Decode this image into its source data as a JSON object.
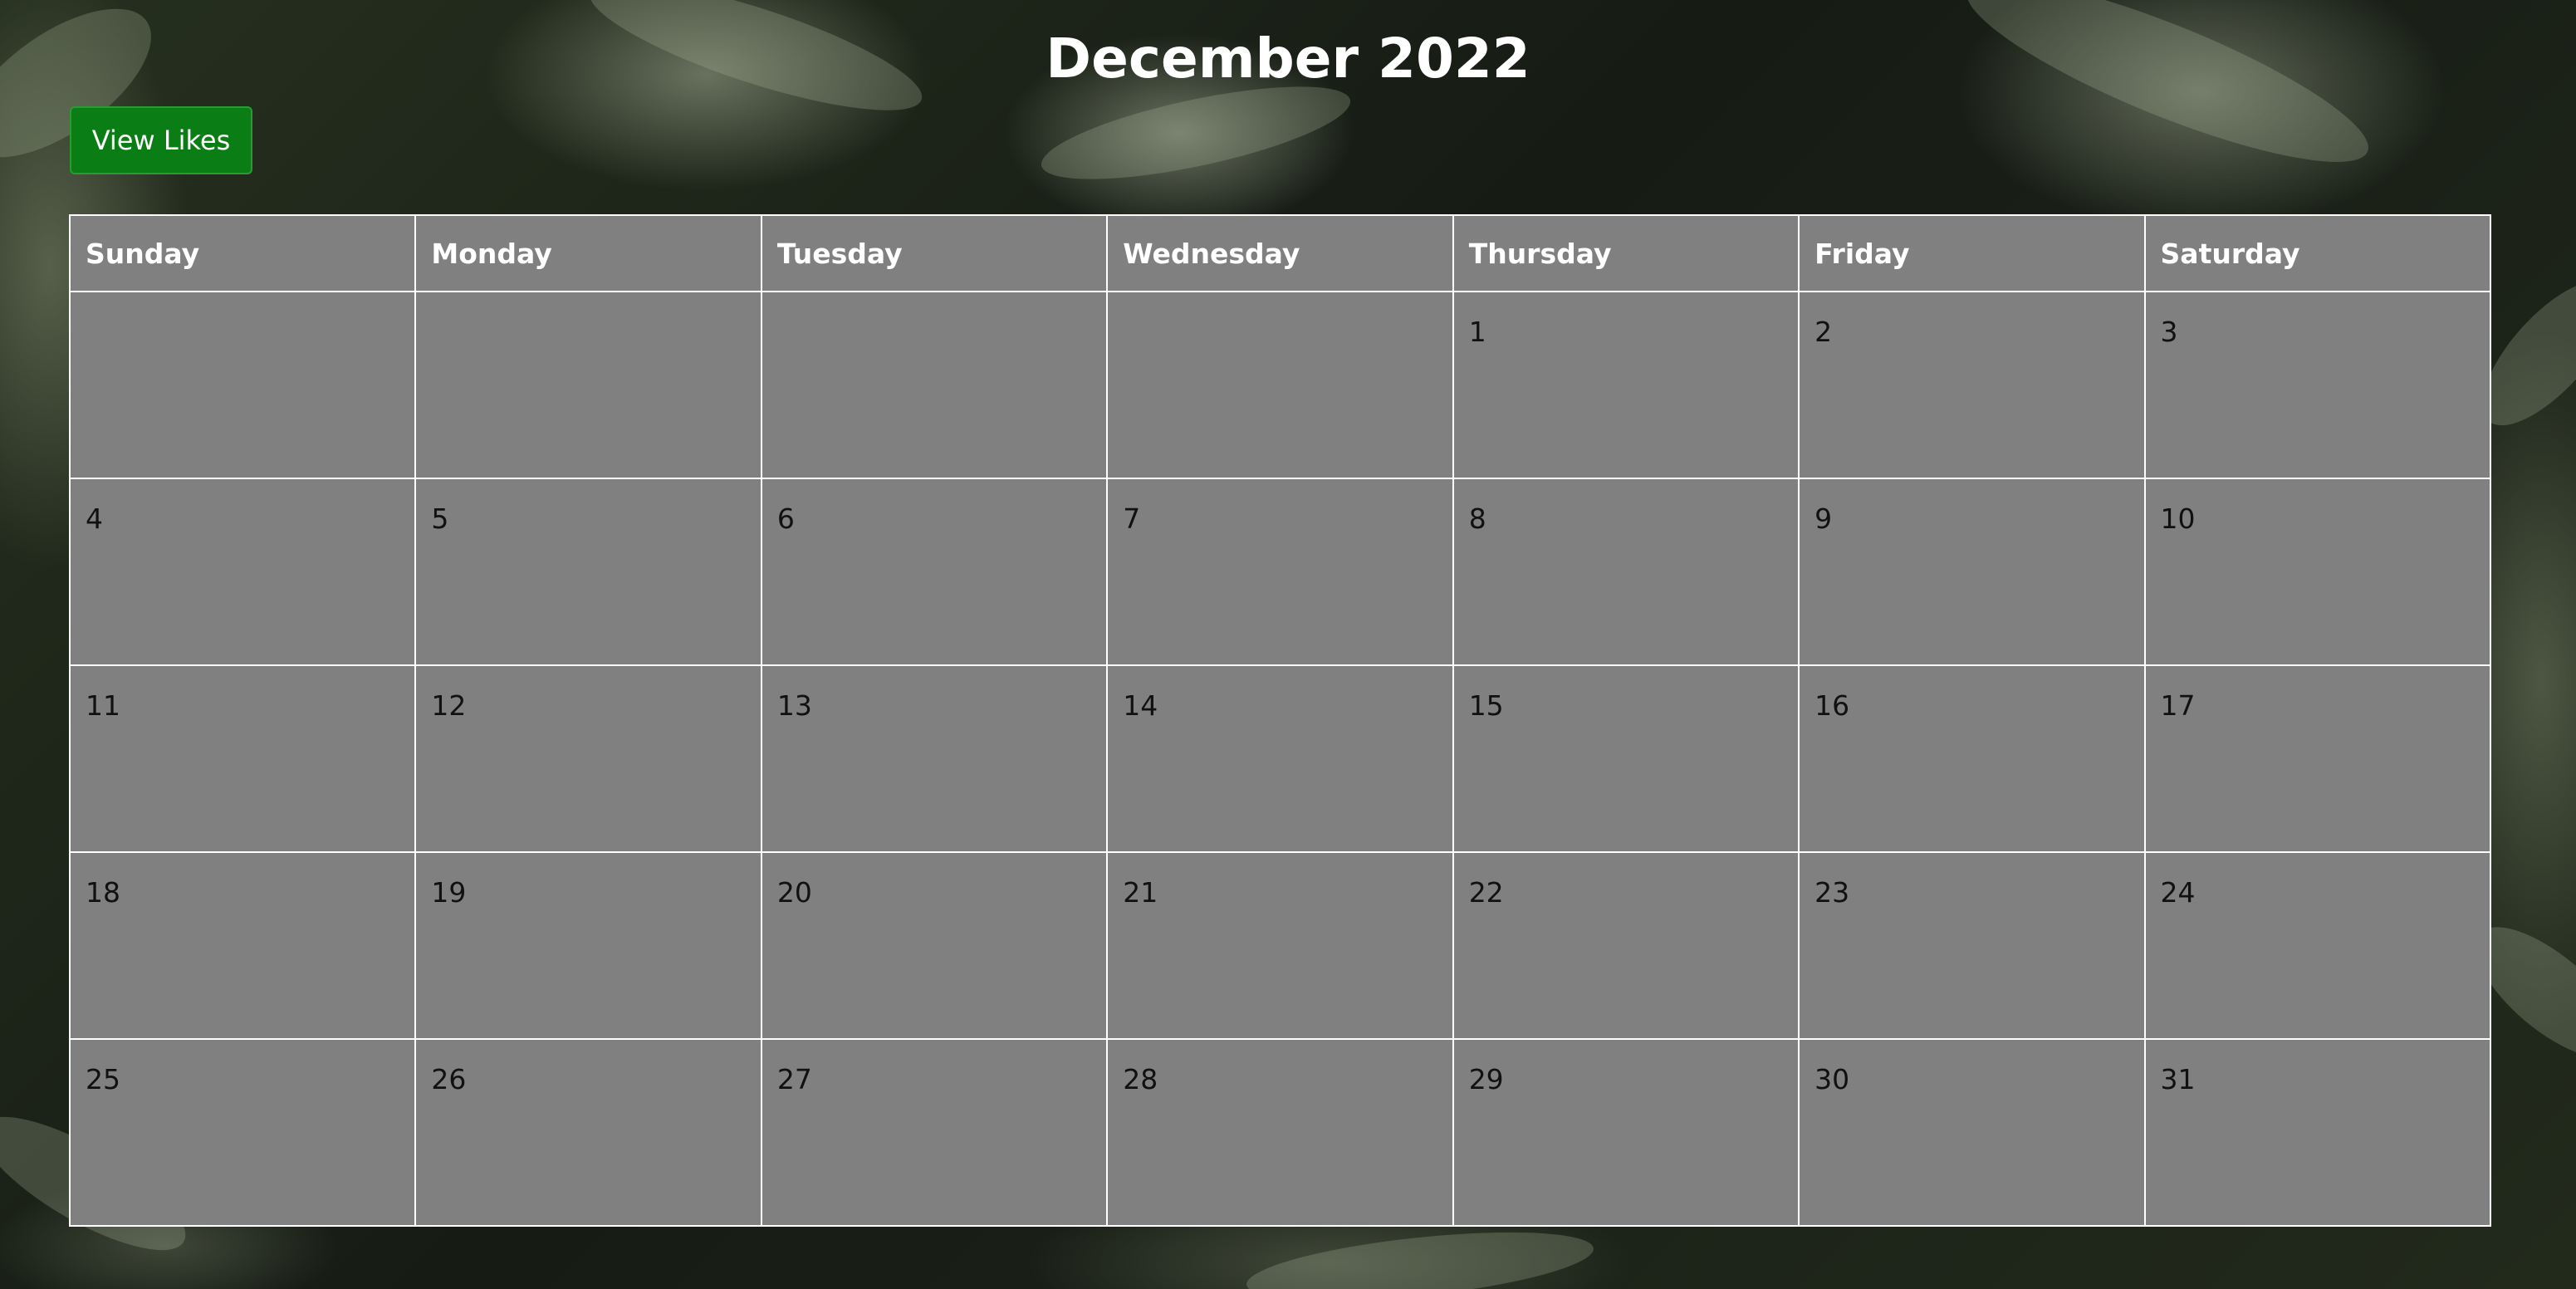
{
  "title": "December 2022",
  "actions": {
    "view_likes_label": "View Likes"
  },
  "colors": {
    "button_background": "#0a7d14",
    "cell_background": "#808080",
    "grid_lines": "#ffffff"
  },
  "calendar": {
    "weekdays": [
      "Sunday",
      "Monday",
      "Tuesday",
      "Wednesday",
      "Thursday",
      "Friday",
      "Saturday"
    ],
    "weeks": [
      [
        "",
        "",
        "",
        "",
        "1",
        "2",
        "3"
      ],
      [
        "4",
        "5",
        "6",
        "7",
        "8",
        "9",
        "10"
      ],
      [
        "11",
        "12",
        "13",
        "14",
        "15",
        "16",
        "17"
      ],
      [
        "18",
        "19",
        "20",
        "21",
        "22",
        "23",
        "24"
      ],
      [
        "25",
        "26",
        "27",
        "28",
        "29",
        "30",
        "31"
      ]
    ]
  }
}
